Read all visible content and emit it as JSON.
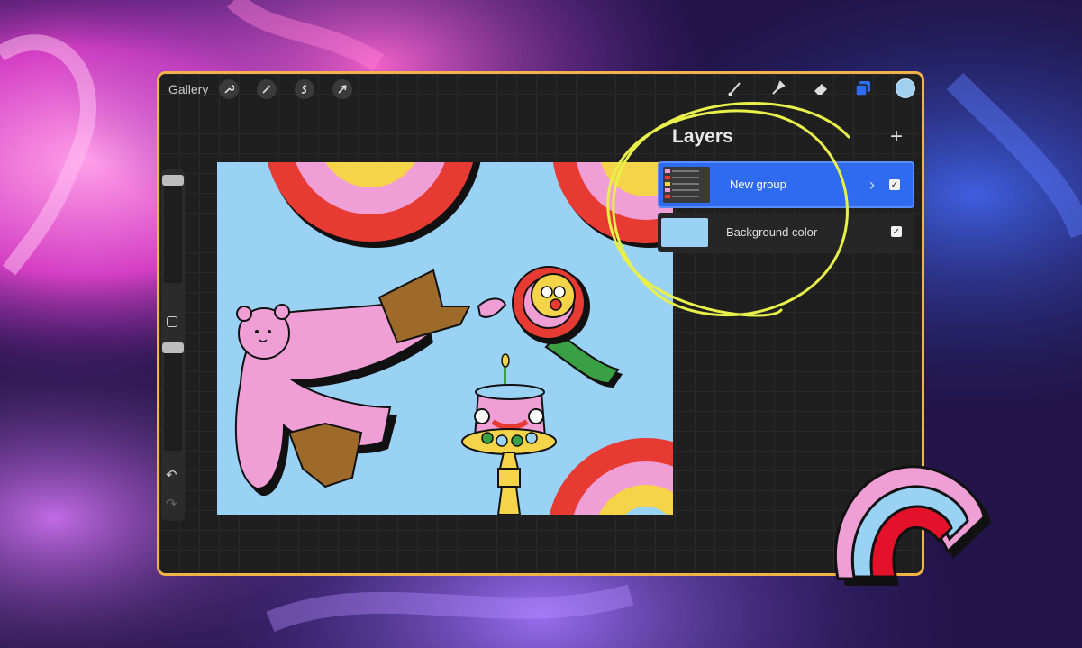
{
  "toolbar": {
    "gallery_label": "Gallery",
    "left_icons": [
      "wrench-icon",
      "magic-wand-icon",
      "selection-icon",
      "arrow-cursor-icon"
    ],
    "right_icons": [
      "brush-icon",
      "smudge-icon",
      "eraser-icon",
      "layers-icon"
    ],
    "current_color": "#9fd0f0"
  },
  "layers": {
    "title": "Layers",
    "add_label": "+",
    "items": [
      {
        "name": "New group",
        "selected": true,
        "visible": true,
        "expandable": true
      },
      {
        "name": "Background color",
        "selected": false,
        "visible": true,
        "expandable": false
      }
    ]
  },
  "colors": {
    "frame": "#f2b24a",
    "selection": "#2e6bf0",
    "canvas_bg": "#9ad2f6",
    "highlight_scribble": "#e9f04a"
  }
}
